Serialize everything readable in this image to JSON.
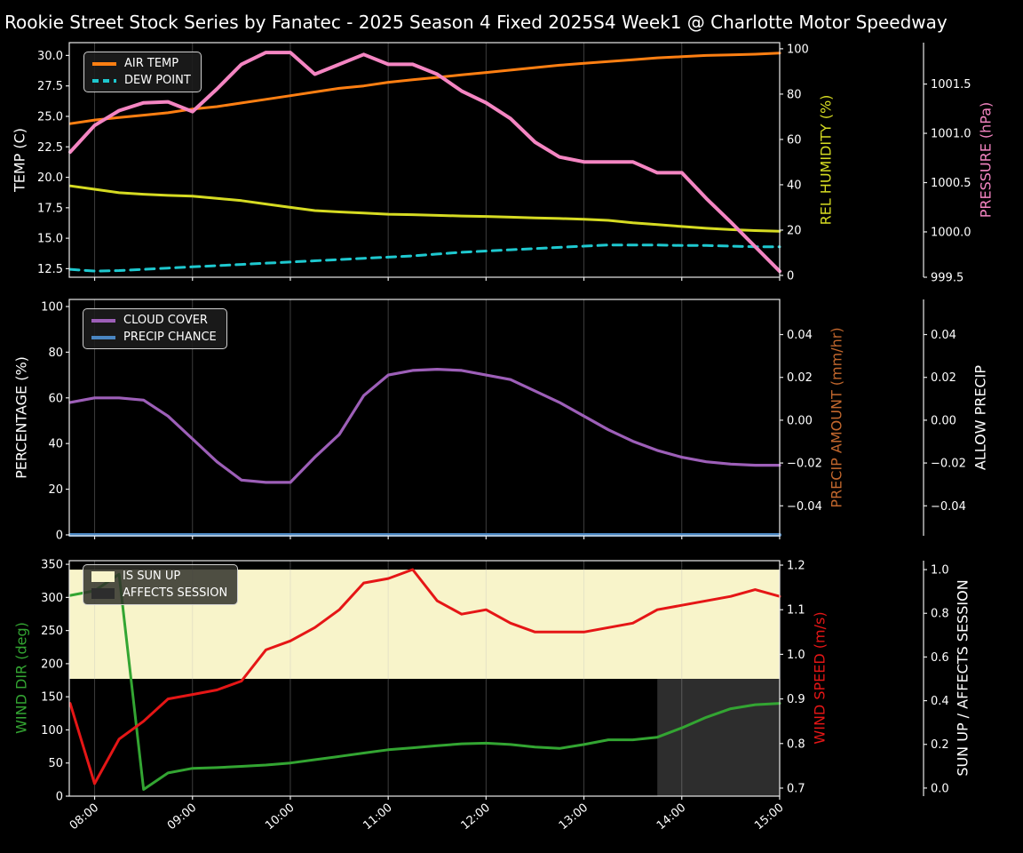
{
  "title": "Rookie Street Stock Series by Fanatec - 2025 Season 4 Fixed 2025S4 Week1 @ Charlotte Motor Speedway",
  "colors": {
    "air_temp": "#ff7f12",
    "dew_point": "#1ec8cf",
    "rel_humidity": "#d6db22",
    "pressure": "#f485c2",
    "cloud_cover": "#9d5fb8",
    "precip_chance": "#4a86c2",
    "precip_amount_axis": "#c2672d",
    "wind_dir": "#33a532",
    "wind_speed": "#e51616",
    "sun_band": "#f8f4ca",
    "affects_band": "#2d2d2d",
    "white": "#ffffff"
  },
  "chart_data": {
    "type": "line",
    "x_times": [
      "07:45",
      "08:00",
      "08:15",
      "08:30",
      "08:45",
      "09:00",
      "09:15",
      "09:30",
      "09:45",
      "10:00",
      "10:15",
      "10:30",
      "10:45",
      "11:00",
      "11:15",
      "11:30",
      "11:45",
      "12:00",
      "12:15",
      "12:30",
      "12:45",
      "13:00",
      "13:15",
      "13:30",
      "13:45",
      "14:00",
      "14:15",
      "14:30",
      "14:45",
      "15:00"
    ],
    "x_tick_labels": [
      "08:00",
      "09:00",
      "10:00",
      "11:00",
      "12:00",
      "13:00",
      "14:00",
      "15:00"
    ],
    "grid": "vertical-hourly",
    "panels": [
      {
        "name": "temperature-humidity-pressure",
        "legend": [
          {
            "label": "AIR TEMP",
            "type": "line",
            "color": "#ff7f12"
          },
          {
            "label": "DEW POINT",
            "type": "dash",
            "color": "#1ec8cf"
          }
        ],
        "axes": {
          "left": {
            "title": "TEMP (C)",
            "title_color": "#ffffff",
            "range": [
              11.8,
              31.05
            ],
            "tick_vals": [
              12.5,
              15.0,
              17.5,
              20.0,
              22.5,
              25.0,
              27.5,
              30.0
            ],
            "tick_labels": [
              "12.5",
              "15.0",
              "17.5",
              "20.0",
              "22.5",
              "25.0",
              "27.5",
              "30.0"
            ]
          },
          "right1": {
            "title": "REL HUMIDITY (%)",
            "title_color": "#d6db22",
            "range": [
              -0.8,
              102.7
            ],
            "tick_vals": [
              0,
              20,
              40,
              60,
              80,
              100
            ],
            "tick_labels": [
              "0",
              "20",
              "40",
              "60",
              "80",
              "100"
            ]
          },
          "right2": {
            "title": "PRESSURE (hPa)",
            "title_color": "#f485c2",
            "range": [
              999.54,
              1001.92
            ],
            "tick_vals": [
              999.5,
              1000.0,
              1000.5,
              1001.0,
              1001.5
            ],
            "tick_labels": [
              "999.5",
              "1000.0",
              "1000.5",
              "1001.0",
              "1001.5"
            ]
          }
        },
        "series": [
          {
            "name": "AIR TEMP",
            "axis": "left",
            "color": "#ff7f12",
            "width": 3,
            "values": [
              24.4,
              24.7,
              24.9,
              25.1,
              25.3,
              25.6,
              25.8,
              26.1,
              26.4,
              26.7,
              27.0,
              27.3,
              27.5,
              27.8,
              28.0,
              28.2,
              28.4,
              28.6,
              28.8,
              29.0,
              29.2,
              29.35,
              29.5,
              29.65,
              29.8,
              29.9,
              30.0,
              30.05,
              30.1,
              30.2
            ]
          },
          {
            "name": "DEW POINT",
            "axis": "left",
            "color": "#1ec8cf",
            "width": 3,
            "dash": "10 7",
            "values": [
              12.45,
              12.3,
              12.35,
              12.45,
              12.55,
              12.65,
              12.75,
              12.85,
              12.95,
              13.05,
              13.15,
              13.25,
              13.35,
              13.45,
              13.55,
              13.7,
              13.85,
              13.95,
              14.05,
              14.15,
              14.25,
              14.35,
              14.45,
              14.45,
              14.45,
              14.4,
              14.4,
              14.35,
              14.3,
              14.3
            ]
          },
          {
            "name": "REL HUMIDITY",
            "axis": "right1",
            "color": "#d6db22",
            "width": 3,
            "values": [
              39.5,
              38.0,
              36.5,
              35.8,
              35.3,
              35.0,
              34.0,
              33.0,
              31.5,
              30.0,
              28.6,
              28.0,
              27.5,
              27.0,
              26.8,
              26.5,
              26.2,
              26.0,
              25.7,
              25.4,
              25.1,
              24.8,
              24.3,
              23.2,
              22.4,
              21.6,
              20.8,
              20.2,
              19.8,
              19.5
            ]
          },
          {
            "name": "PRESSURE",
            "axis": "right2",
            "color": "#f485c2",
            "width": 4,
            "values": [
              1000.81,
              1001.08,
              1001.23,
              1001.31,
              1001.32,
              1001.22,
              1001.45,
              1001.7,
              1001.82,
              1001.82,
              1001.6,
              1001.7,
              1001.8,
              1001.7,
              1001.7,
              1001.6,
              1001.43,
              1001.31,
              1001.15,
              1000.91,
              1000.76,
              1000.71,
              1000.71,
              1000.71,
              1000.6,
              1000.6,
              1000.34,
              1000.1,
              999.85,
              999.6
            ]
          }
        ]
      },
      {
        "name": "cloud-precip",
        "legend": [
          {
            "label": "CLOUD COVER",
            "type": "line",
            "color": "#9d5fb8"
          },
          {
            "label": "PRECIP CHANCE",
            "type": "line",
            "color": "#4a86c2"
          }
        ],
        "axes": {
          "left": {
            "title": "PERCENTAGE (%)",
            "title_color": "#ffffff",
            "range": [
              -0.4,
              103.1
            ],
            "tick_vals": [
              0,
              20,
              40,
              60,
              80,
              100
            ],
            "tick_labels": [
              "0",
              "20",
              "40",
              "60",
              "80",
              "100"
            ]
          },
          "right1": {
            "title": "PRECIP AMOUNT (mm/hr)",
            "title_color": "#c2672d",
            "range": [
              -0.054,
              0.0564
            ],
            "tick_vals": [
              0.04,
              0.02,
              0.0,
              -0.02,
              -0.04
            ],
            "tick_labels": [
              "0.04",
              "0.02",
              "0.00",
              "−0.02",
              "−0.04"
            ]
          },
          "right2": {
            "title": "ALLOW PRECIP",
            "title_color": "#ffffff",
            "range": [
              -0.054,
              0.0564
            ],
            "tick_vals": [
              0.04,
              0.02,
              0.0,
              -0.02,
              -0.04
            ],
            "tick_labels": [
              "0.04",
              "0.02",
              "0.00",
              "−0.02",
              "−0.04"
            ]
          }
        },
        "series": [
          {
            "name": "CLOUD COVER",
            "axis": "left",
            "color": "#9d5fb8",
            "width": 3.2,
            "values": [
              58,
              60,
              60,
              59,
              52,
              42,
              32,
              24,
              23,
              23,
              34,
              44,
              61,
              70,
              72,
              72.5,
              72,
              70,
              68,
              63,
              58,
              52,
              46,
              41,
              37,
              34,
              32,
              31,
              30.5,
              30.5
            ]
          },
          {
            "name": "PRECIP CHANCE",
            "axis": "left",
            "color": "#4a86c2",
            "width": 4,
            "values": [
              0,
              0,
              0,
              0,
              0,
              0,
              0,
              0,
              0,
              0,
              0,
              0,
              0,
              0,
              0,
              0,
              0,
              0,
              0,
              0,
              0,
              0,
              0,
              0,
              0,
              0,
              0,
              0,
              0,
              0
            ]
          }
        ]
      },
      {
        "name": "wind-sun",
        "legend": [
          {
            "label": "IS SUN UP",
            "type": "patch",
            "color": "#f8f4ca"
          },
          {
            "label": "AFFECTS SESSION",
            "type": "patch",
            "color": "#2d2d2d"
          }
        ],
        "axes": {
          "left": {
            "title": "WIND DIR (deg)",
            "title_color": "#33a532",
            "range": [
              0,
              355.5
            ],
            "tick_vals": [
              0,
              50,
              100,
              150,
              200,
              250,
              300,
              350
            ],
            "tick_labels": [
              "0",
              "50",
              "100",
              "150",
              "200",
              "250",
              "300",
              "350"
            ]
          },
          "right1": {
            "title": "WIND SPEED (m/s)",
            "title_color": "#e51616",
            "range": [
              0.682,
              1.21
            ],
            "tick_vals": [
              0.7,
              0.8,
              0.9,
              1.0,
              1.1,
              1.2
            ],
            "tick_labels": [
              "0.7",
              "0.8",
              "0.9",
              "1.0",
              "1.1",
              "1.2"
            ]
          },
          "right2": {
            "title": "SUN UP / AFFECTS SESSION",
            "title_color": "#ffffff",
            "range": [
              -0.037,
              1.041
            ],
            "tick_vals": [
              0.0,
              0.2,
              0.4,
              0.6,
              0.8,
              1.0
            ],
            "tick_labels": [
              "0.0",
              "0.2",
              "0.4",
              "0.6",
              "0.8",
              "1.0"
            ]
          }
        },
        "bands": [
          {
            "name": "IS SUN UP",
            "axis": "right2",
            "color": "#f8f4ca",
            "x_from": null,
            "x_to": null,
            "y_from": 0.5,
            "y_to": 1.0
          },
          {
            "name": "AFFECTS SESSION",
            "axis": "right2",
            "color": "#2d2d2d",
            "x_from": "13:45",
            "x_to": "15:00",
            "y_from": -0.037,
            "y_to": 0.5
          }
        ],
        "series": [
          {
            "name": "WIND DIR",
            "axis": "left",
            "color": "#33a532",
            "width": 3,
            "values": [
              303,
              310,
              335,
              10,
              35,
              42,
              43,
              45,
              47,
              50,
              55,
              60,
              65,
              70,
              73,
              76,
              79,
              80,
              78,
              74,
              72,
              78,
              85,
              85,
              89,
              103,
              119,
              132,
              138,
              140
            ]
          },
          {
            "name": "WIND SPEED",
            "axis": "right1",
            "color": "#e51616",
            "width": 3,
            "values": [
              0.89,
              0.71,
              0.81,
              0.85,
              0.9,
              0.91,
              0.92,
              0.94,
              1.01,
              1.03,
              1.06,
              1.1,
              1.16,
              1.17,
              1.19,
              1.12,
              1.09,
              1.1,
              1.07,
              1.05,
              1.05,
              1.05,
              1.06,
              1.07,
              1.1,
              1.11,
              1.12,
              1.13,
              1.145,
              1.13
            ]
          }
        ]
      }
    ]
  }
}
